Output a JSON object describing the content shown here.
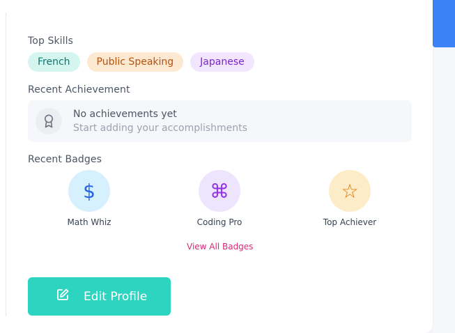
{
  "skills": {
    "heading": "Top Skills",
    "items": [
      "French",
      "Public Speaking",
      "Japanese"
    ]
  },
  "achievement": {
    "heading": "Recent Achievement",
    "icon": "award-icon",
    "title": "No achievements yet",
    "subtitle": "Start adding your accomplishments"
  },
  "badges": {
    "heading": "Recent Badges",
    "items": [
      {
        "name": "Math Whiz",
        "glyph": "$",
        "icon": "dollar-icon",
        "bg": "#d7f0fd",
        "fg": "#2563eb"
      },
      {
        "name": "Coding Pro",
        "glyph": "⌘",
        "icon": "command-icon",
        "bg": "#ede5fd",
        "fg": "#9333ea"
      },
      {
        "name": "Top Achiever",
        "glyph": "☆",
        "icon": "star-icon",
        "bg": "#fdecc8",
        "fg": "#d97706"
      }
    ],
    "view_all": "View All Badges"
  },
  "edit_button": {
    "label": "Edit Profile",
    "icon": "edit-icon"
  },
  "colors": {
    "accent": "#2dd4bf",
    "link": "#db2777",
    "sidebar_blue": "#3b82f6"
  }
}
